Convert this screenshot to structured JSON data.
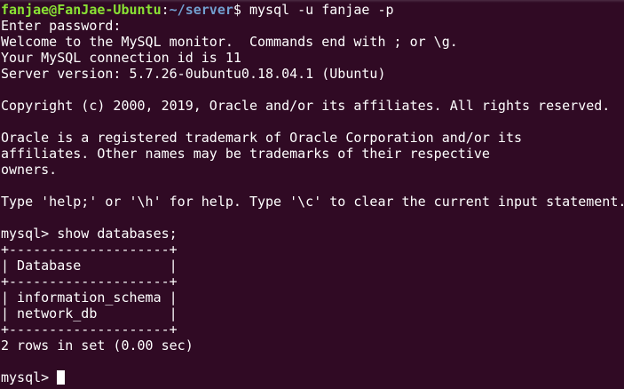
{
  "prompt_line": {
    "user_host": "fanjae@FanJae-Ubuntu",
    "separator": ":",
    "path": "~/server",
    "symbol": "$ ",
    "command": "mysql -u fanjae -p"
  },
  "output": [
    "Enter password:",
    "Welcome to the MySQL monitor.  Commands end with ; or \\g.",
    "Your MySQL connection id is 11",
    "Server version: 5.7.26-0ubuntu0.18.04.1 (Ubuntu)",
    "",
    "Copyright (c) 2000, 2019, Oracle and/or its affiliates. All rights reserved.",
    "",
    "Oracle is a registered trademark of Oracle Corporation and/or its",
    "affiliates. Other names may be trademarks of their respective",
    "owners.",
    "",
    "Type 'help;' or '\\h' for help. Type '\\c' to clear the current input statement.",
    "",
    "mysql> show databases;",
    "+--------------------+",
    "| Database           |",
    "+--------------------+",
    "| information_schema |",
    "| network_db         |",
    "+--------------------+",
    "2 rows in set (0.00 sec)",
    ""
  ],
  "final_prompt": "mysql> ",
  "colors": {
    "background": "#300a24",
    "text": "#ffffff",
    "user_host": "#8ae234",
    "path": "#729fcf"
  }
}
